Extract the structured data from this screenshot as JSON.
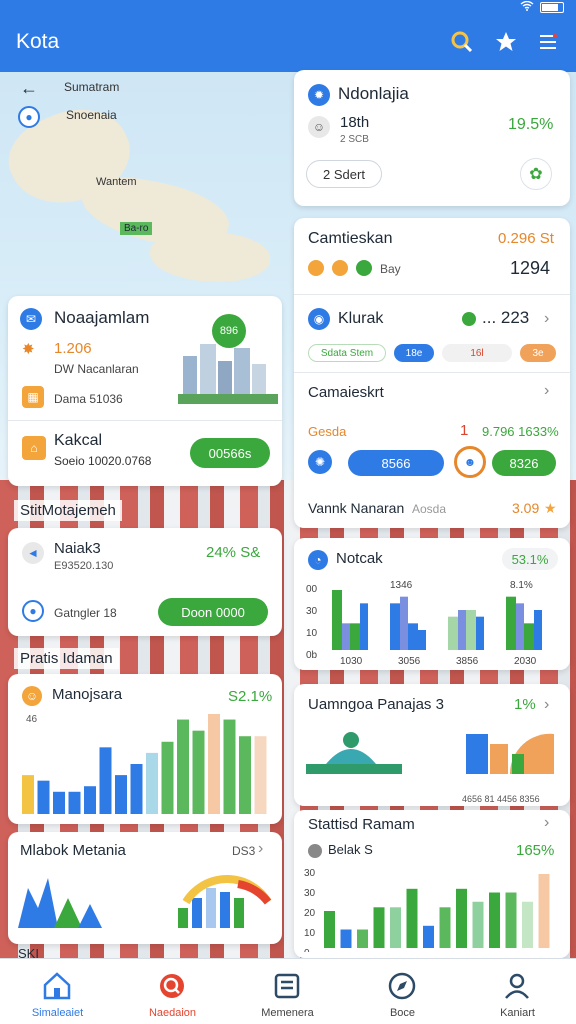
{
  "app": {
    "title": "Kota"
  },
  "statusbar": {
    "battery_text": ""
  },
  "map": {
    "labels": [
      "Sumatram",
      "Snoenaia",
      "Wantem",
      "Ba-ro"
    ],
    "back_icon": "arrow-left-icon"
  },
  "overview": {
    "title": "Ndonlajia",
    "value": "18th",
    "sub": "2 SCB",
    "percent": "19.5%",
    "button": "2 Sdert"
  },
  "card_left1": {
    "title": "Noaajamlam",
    "badge": "896",
    "row1_value": "1.206",
    "row1_label": "DW Nacanlaran",
    "row2_label": "Dama 51036",
    "row3_title": "Kakcal",
    "row3_sub": "Soeio 10020.0768",
    "row3_button": "00566s"
  },
  "card_right1": {
    "title": "Camtieskan",
    "value_top": "0.296 St",
    "row_label": "Bay",
    "row_value": "1294",
    "k_title": "Klurak",
    "k_value": "... 223",
    "chips": [
      "Sdata Stem",
      "18e",
      "16l",
      "3e"
    ],
    "section2": "Camaieskrt",
    "s2_left": "Gesda",
    "s2_mid": "1",
    "s2_right": "9.796 1633%",
    "pill1": "8566",
    "pill2": "8326",
    "footer": "Vannk Nanaran",
    "footer_sub": "Aosda",
    "footer_value": "3.09"
  },
  "section_a": {
    "label": "StitMotajemeh"
  },
  "card_left2": {
    "title": "Naiak3",
    "sub": "E93520.130",
    "percent": "24% S&",
    "row_label": "Gatngler 18",
    "button": "Doon 0000"
  },
  "notoak": {
    "title": "Notcak",
    "percent": "53.1%",
    "left_ticks": [
      "00",
      "30",
      "10",
      "0b"
    ],
    "top_labels": [
      "1346",
      "8.1%"
    ],
    "x_labels": [
      "1030",
      "3056",
      "3856",
      "2030"
    ]
  },
  "section_b": {
    "label": "Pratis Idaman"
  },
  "card_left3": {
    "title": "Manojsara",
    "percent": "S2.1%",
    "side_label": "46"
  },
  "card_right3": {
    "title": "Uamngoa Panajas 3",
    "percent": "1%",
    "sub": "4656 81 4456 8356"
  },
  "card_left4": {
    "title": "Mlabok Metania",
    "right": "DS3"
  },
  "card_right4": {
    "title": "Stattisd Ramam",
    "row_label": "Belak S",
    "percent": "165%",
    "ticks": [
      "30",
      "30",
      "20",
      "10",
      "0"
    ]
  },
  "bottom_overflow": {
    "label": "SKI"
  },
  "nav": [
    {
      "label": "Simaleaiet",
      "icon": "home-icon",
      "active": true
    },
    {
      "label": "Naedaion",
      "icon": "search-icon",
      "active": false
    },
    {
      "label": "Memenera",
      "icon": "list-icon",
      "active": false
    },
    {
      "label": "Boce",
      "icon": "compass-icon",
      "active": false
    },
    {
      "label": "Kaniart",
      "icon": "profile-icon",
      "active": false
    }
  ],
  "colors": {
    "primary": "#2f7be6",
    "green": "#3aa83c",
    "orange": "#e5872a",
    "red": "#d9452f"
  },
  "chart_data": [
    {
      "type": "bar",
      "title": "Notcak",
      "categories": [
        "1030",
        "3056",
        "3856",
        "2030"
      ],
      "series": [
        {
          "values": [
            45,
            20,
            35,
            20,
            25,
            30,
            40,
            20
          ]
        },
        {
          "values": [
            20,
            35,
            40,
            15,
            30,
            25,
            35,
            30
          ]
        }
      ]
    },
    {
      "type": "bar",
      "title": "Manojsara",
      "series": [
        {
          "values": [
            35,
            30,
            20,
            20,
            25,
            60,
            35,
            45,
            55,
            65,
            85,
            75,
            90,
            85,
            70,
            70
          ]
        }
      ]
    },
    {
      "type": "bar",
      "title": "Stattisd Ramam",
      "series": [
        {
          "values": [
            20,
            10,
            10,
            22,
            22,
            32,
            12,
            22,
            32,
            25,
            30,
            30,
            25,
            40
          ]
        }
      ]
    }
  ]
}
